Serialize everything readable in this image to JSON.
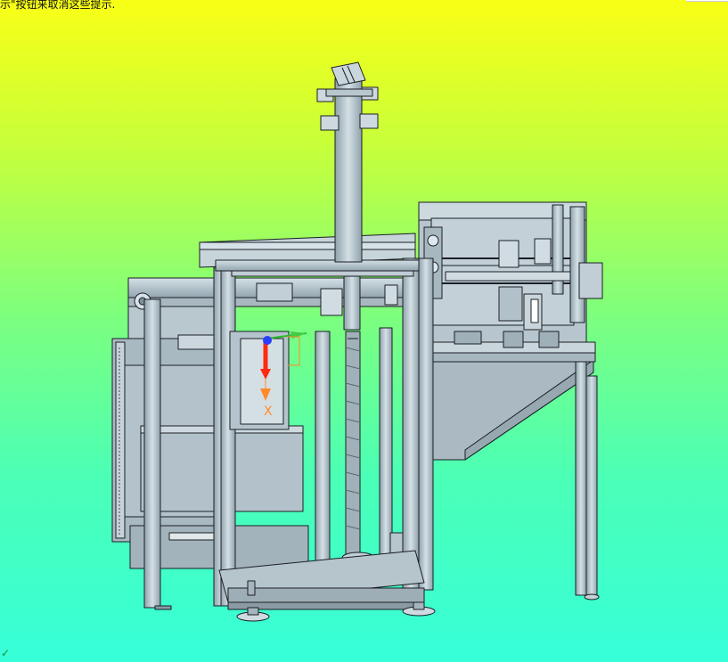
{
  "viewport": {
    "hint_text": "示\"按钮来取消这些提示.",
    "axis_label": "X",
    "corner_glyph": "✓"
  },
  "colors": {
    "background_top": "#f9ff16",
    "background_bottom": "#36ffd9",
    "metal_face": "#b8c7d0",
    "metal_light": "#d6e2e8",
    "metal_dark": "#8a9ba5",
    "edge": "#1a1f24",
    "triad_x": "#ff2a10",
    "triad_y": "#2fb82f",
    "triad_z": "#2a3cff",
    "axis_label": "#ff8a2a"
  },
  "icons": {
    "reference_triad": "triad-icon",
    "corner_indicator": "corner-check-icon"
  }
}
